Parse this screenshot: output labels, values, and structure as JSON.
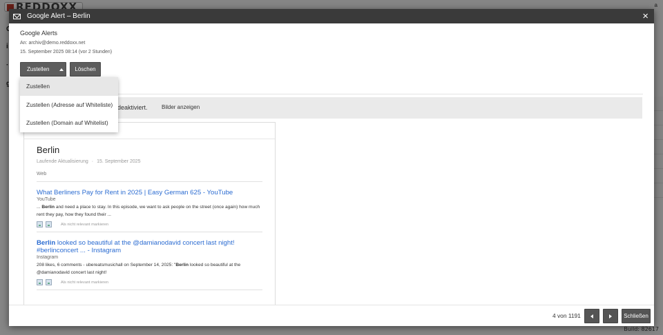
{
  "background": {
    "logo_text": "REDDOXX",
    "build": "Build: 82617",
    "corner_char": "a"
  },
  "dialog": {
    "title": "Google Alert – Berlin",
    "sender": "Google Alerts",
    "to": "An: archiv@demo.reddoxx.net",
    "date": "15. September 2025 08:14 (vor 2 Stunden)"
  },
  "actions": {
    "deliver_label": "Zustellen",
    "delete_label": "Löschen"
  },
  "dropdown": {
    "items": [
      {
        "label": "Zustellen"
      },
      {
        "label": "Zustellen (Adresse auf Whiteliste)"
      },
      {
        "label": "Zustellen (Domain auf Whitelist)"
      }
    ]
  },
  "images_bar": {
    "notice": "deaktiviert.",
    "show_images": "Bilder anzeigen"
  },
  "email": {
    "alert_title": "Berlin",
    "subline_left": "Laufende Aktualisierung",
    "subline_sep": "·",
    "subline_right": "15. September 2025",
    "category": "Web",
    "results": [
      {
        "title_bold": "",
        "title": "What Berliners Pay for Rent in 2025 | Easy German 625 - YouTube",
        "source": "YouTube",
        "snippet_pre": "... ",
        "snippet_bold": "Berlin",
        "snippet_post": " and need a place to stay. In this episode, we want to ask people on the street (once again) how much rent they pay, how they found their ...",
        "mark_label": "Als nicht relevant markieren"
      },
      {
        "title_bold": "Berlin",
        "title": " looked so beautiful at the @damianodavid concert last night! #berlinconcert ... - Instagram",
        "source": "Instagram",
        "snippet_pre": "208 likes, 6 comments - ubereatsmusichall on September 14, 2025: \"",
        "snippet_bold": "Berlin",
        "snippet_post": " looked so beautiful at the @damianodavid concert last night!",
        "mark_label": "Als nicht relevant markieren"
      }
    ]
  },
  "footer": {
    "count": "4 von 1191",
    "close_label": "Schließen"
  }
}
